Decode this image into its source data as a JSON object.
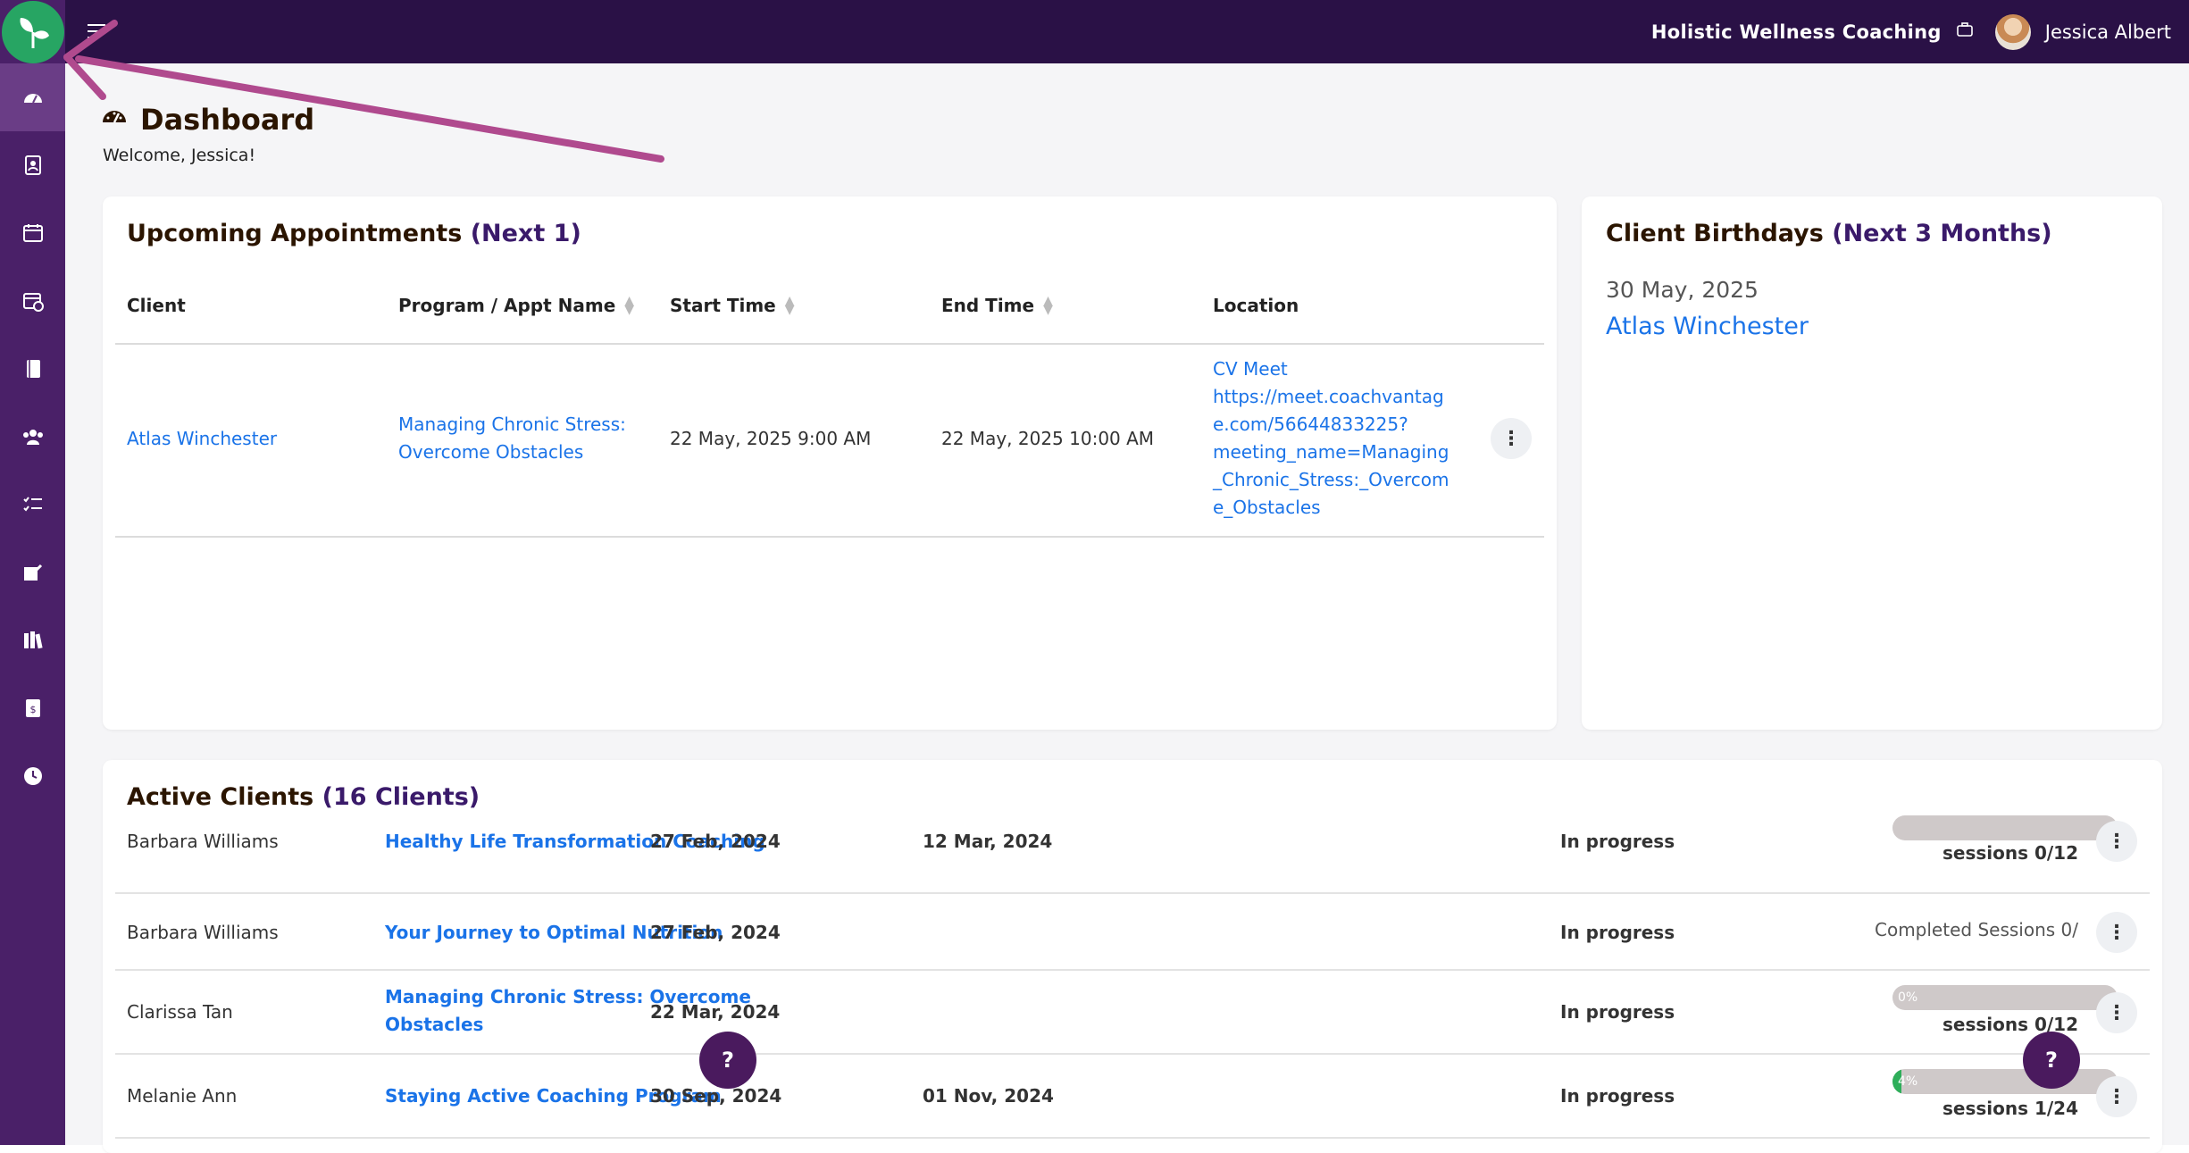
{
  "header": {
    "company": "Holistic Wellness Coaching",
    "username": "Jessica Albert"
  },
  "page": {
    "title": "Dashboard",
    "welcome": "Welcome, Jessica!"
  },
  "appointments": {
    "title": "Upcoming Appointments",
    "title_accent": "(Next 1)",
    "columns": [
      "Client",
      "Program / Appt Name",
      "Start Time",
      "End Time",
      "Location"
    ],
    "rows": [
      {
        "client": "Atlas Winchester",
        "program_line1": "Managing Chronic Stress:",
        "program_line2": "Overcome Obstacles",
        "start": "22 May, 2025 9:00 AM",
        "end": "22 May, 2025 10:00 AM",
        "location_lines": [
          "CV Meet",
          "https://meet.coachvantag",
          "e.com/56644833225?",
          "meeting_name=Managing",
          "_Chronic_Stress:_Overcom",
          "e_Obstacles"
        ]
      }
    ]
  },
  "birthdays": {
    "title": "Client Birthdays",
    "title_accent": "(Next 3 Months)",
    "date": "30 May, 2025",
    "name": "Atlas Winchester"
  },
  "active_clients": {
    "title": "Active Clients",
    "title_accent": "(16 Clients)",
    "rows": [
      {
        "name": "Barbara Williams",
        "program": "Healthy Life Transformation Coaching",
        "program2": "",
        "start": "27 Feb, 2024",
        "end": "12 Mar, 2024",
        "status": "In progress",
        "sessions": "sessions 0/12",
        "progress": 0,
        "bar_label": ""
      },
      {
        "name": "Barbara Williams",
        "program": "Your Journey to Optimal Nutrition",
        "program2": "",
        "start": "27 Feb, 2024",
        "end": "",
        "status": "In progress",
        "completed": "Completed Sessions 0/"
      },
      {
        "name": "Clarissa Tan",
        "program": "Managing Chronic Stress: Overcome",
        "program2": "Obstacles",
        "start": "22 Mar, 2024",
        "end": "",
        "status": "In progress",
        "sessions": "sessions 0/12",
        "progress": 0,
        "bar_label": "0%"
      },
      {
        "name": "Melanie Ann",
        "program": "Staying Active Coaching Program",
        "program2": "",
        "start": "30 Sep, 2024",
        "end": "01 Nov, 2024",
        "status": "In progress",
        "sessions": "sessions 1/24",
        "progress": 0.04,
        "bar_label": "4%"
      }
    ]
  },
  "help_label": "?",
  "colors": {
    "sidebar": "#4a2068",
    "topbar": "#2a1146",
    "accent": "#3a1a6a",
    "link": "#1a73e8",
    "logo": "#27a563",
    "annotation_arrow": "#b04a8e"
  }
}
